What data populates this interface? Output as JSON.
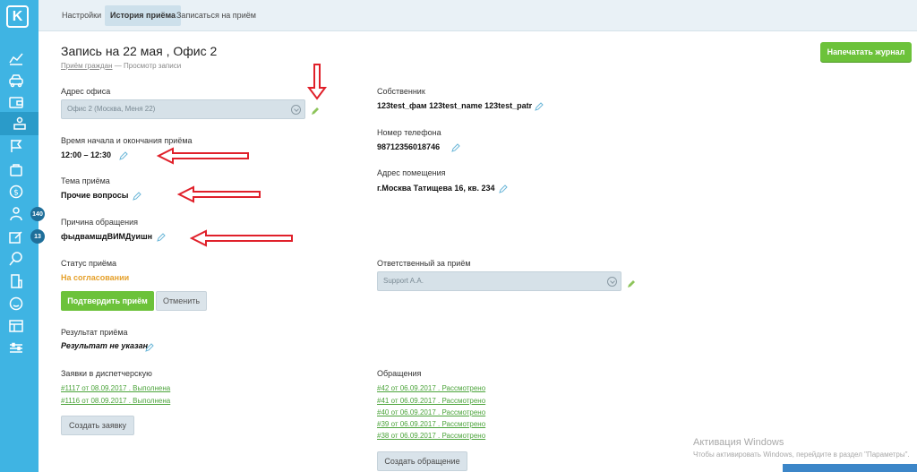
{
  "sidebar": {
    "logo": "K",
    "icons": [
      "chart-icon",
      "car-icon",
      "wallet-icon",
      "meeting-icon",
      "flag-icon",
      "bag-icon",
      "coin-icon",
      "people-icon",
      "edit-icon",
      "pin-icon",
      "building-icon",
      "smile-icon",
      "table-icon",
      "sliders-icon"
    ],
    "badges": {
      "people": "140",
      "edit": "13"
    }
  },
  "topnav": {
    "tabs": [
      "Настройки",
      "История приёма",
      "Записаться на приём"
    ]
  },
  "header": {
    "title": "Запись на 22 мая , Офис 2",
    "breadcrumb_link": "Приём граждан",
    "breadcrumb_sep": "—",
    "breadcrumb_current": "Просмотр записи",
    "print_button": "Напечатать журнал"
  },
  "left": {
    "office_label": "Адрес офиса",
    "office_value": "Офис 2 (Москва, Меня 22)",
    "time_label": "Время начала и окончания приёма",
    "time_value": "12:00 – 12:30",
    "topic_label": "Тема приёма",
    "topic_value": "Прочие вопросы",
    "reason_label": "Причина обращения",
    "reason_value": "фыдвамшдВИМДуишн",
    "status_label": "Статус приёма",
    "status_value": "На согласовании",
    "confirm_button": "Подтвердить приём",
    "cancel_button": "Отменить",
    "result_label": "Результат приёма",
    "result_value": "Результат не указан",
    "requests_label": "Заявки в диспетчерскую",
    "requests": [
      "#1117 от 08.09.2017 . Выполнена",
      "#1116 от 08.09.2017 . Выполнена"
    ],
    "create_request_button": "Создать заявку"
  },
  "right": {
    "owner_label": "Собственник",
    "owner_value": "123test_фам 123test_name 123test_patr",
    "phone_label": "Номер телефона",
    "phone_value": "98712356018746",
    "address_label": "Адрес помещения",
    "address_value": "г.Москва Татищева 16, кв. 234",
    "responsible_label": "Ответственный за приём",
    "responsible_value": "Support A.A.",
    "appeals_label": "Обращения",
    "appeals": [
      "#42 от 06.09.2017 . Рассмотрено",
      "#41 от 06.09.2017 . Рассмотрено",
      "#40 от 06.09.2017 . Рассмотрено",
      "#39 от 06.09.2017 . Рассмотрено",
      "#38 от 06.09.2017 . Рассмотрено"
    ],
    "create_appeal_button": "Создать обращение"
  },
  "watermark": {
    "title": "Активация Windows",
    "subtitle": "Чтобы активировать Windows, перейдите в раздел \"Параметры\"."
  },
  "colors": {
    "sidebar": "#3fb4e3",
    "accent_green": "#6cc23a",
    "status_orange": "#e5a02a",
    "link_green": "#4ca43b",
    "arrow_red": "#e0202a"
  }
}
